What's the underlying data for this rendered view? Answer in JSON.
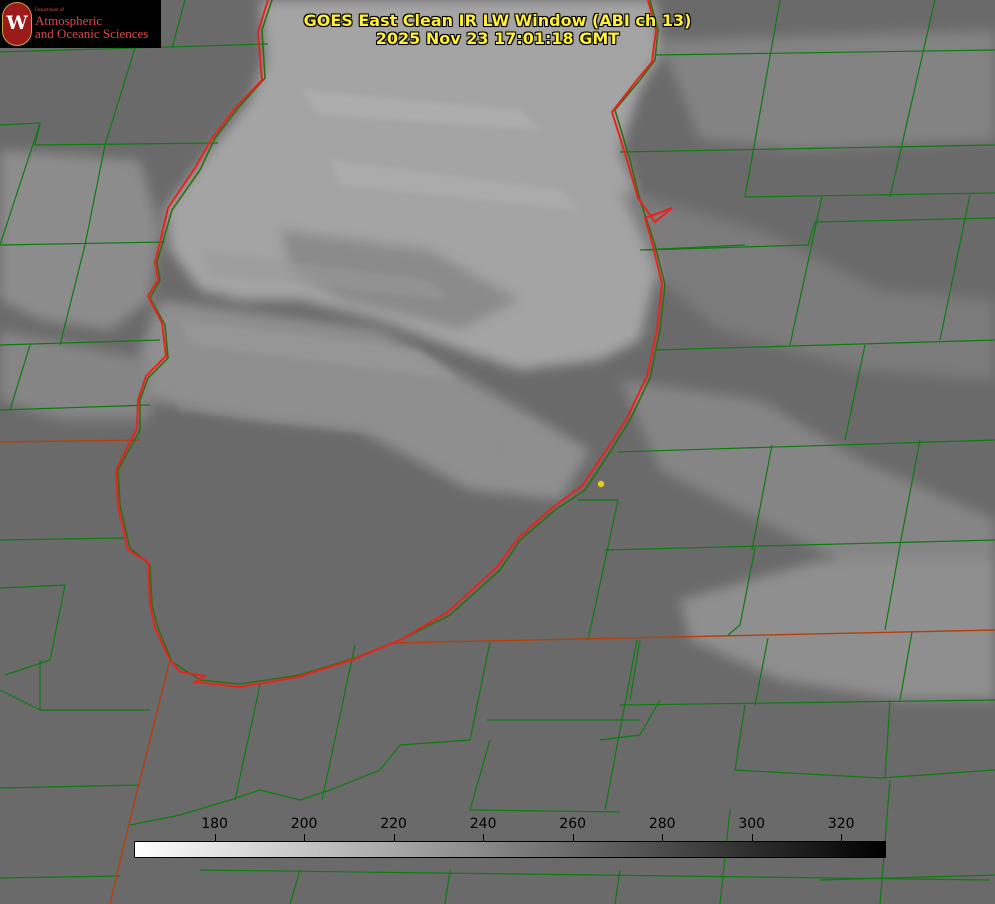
{
  "title": {
    "line1": "GOES East Clean IR LW Window (ABI ch 13)",
    "line2": "2025 Nov 23 17:01:18 GMT"
  },
  "logo": {
    "department": "Department of",
    "line1": "Atmospheric",
    "line2": "and Oceanic Sciences",
    "seal_letter": "W"
  },
  "colorbar": {
    "min": 162,
    "max": 330,
    "ticks": [
      "180",
      "200",
      "220",
      "240",
      "260",
      "280",
      "300",
      "320"
    ],
    "tick_values": [
      180,
      200,
      220,
      240,
      260,
      280,
      300,
      320
    ],
    "colors": {
      "cold": "#ffffff",
      "warm": "#000000"
    }
  },
  "map": {
    "background_color": "#6a6a6a",
    "cloud_color": "#a3a3a3",
    "lake_outline_color": "#e8231f",
    "county_line_color": "#0f7a12",
    "state_line_color": "#b3400e",
    "marker_color": "#e0cf14"
  }
}
